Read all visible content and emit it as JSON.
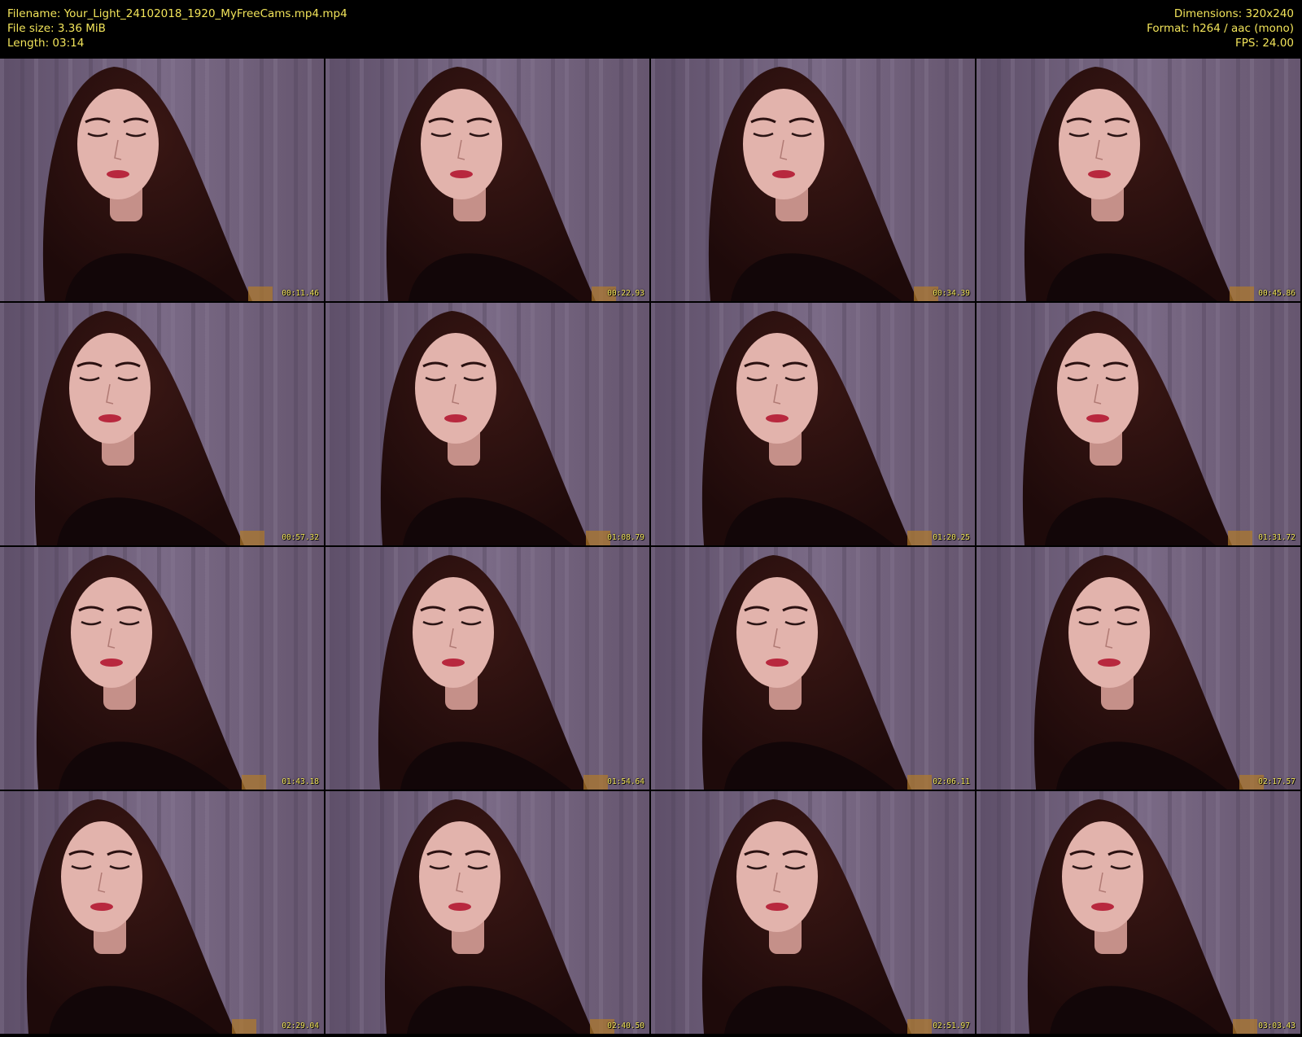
{
  "header": {
    "filename": "Filename: Your_Light_24102018_1920_MyFreeCams.mp4.mp4",
    "filesize": "File size: 3.36 MiB",
    "length": "Length: 03:14",
    "dimensions": "Dimensions: 320x240",
    "format": "Format: h264 / aac (mono)",
    "fps": "FPS: 24.00"
  },
  "colors": {
    "text": "#f2e45a",
    "background": "#000000",
    "curtain": "#6e5d78"
  },
  "frames": [
    {
      "time": "00:11.46"
    },
    {
      "time": "00:22.93"
    },
    {
      "time": "00:34.39"
    },
    {
      "time": "00:45.86"
    },
    {
      "time": "00:57.32"
    },
    {
      "time": "01:08.79"
    },
    {
      "time": "01:20.25"
    },
    {
      "time": "01:31.72"
    },
    {
      "time": "01:43.18"
    },
    {
      "time": "01:54.64"
    },
    {
      "time": "02:06.11"
    },
    {
      "time": "02:17.57"
    },
    {
      "time": "02:29.04"
    },
    {
      "time": "02:40.50"
    },
    {
      "time": "02:51.97"
    },
    {
      "time": "03:03.43"
    }
  ]
}
